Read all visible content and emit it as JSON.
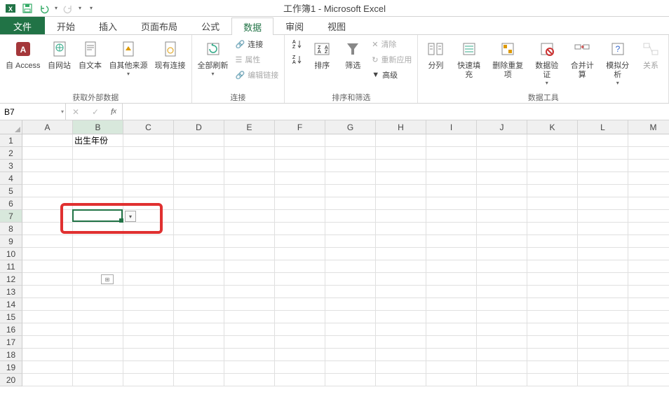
{
  "title": "工作簿1 - Microsoft Excel",
  "tabs": {
    "file": "文件",
    "home": "开始",
    "insert": "插入",
    "layout": "页面布局",
    "formulas": "公式",
    "data": "数据",
    "review": "审阅",
    "view": "视图"
  },
  "ribbon": {
    "group_external": "获取外部数据",
    "from_access": "自 Access",
    "from_web": "自网站",
    "from_text": "自文本",
    "from_other": "自其他来源",
    "existing_conn": "现有连接",
    "group_conn": "连接",
    "refresh_all": "全部刷新",
    "connections": "连接",
    "properties": "属性",
    "edit_links": "编辑链接",
    "group_sort": "排序和筛选",
    "sort": "排序",
    "filter": "筛选",
    "clear": "清除",
    "reapply": "重新应用",
    "advanced": "高级",
    "group_tools": "数据工具",
    "text_to_cols": "分列",
    "flash_fill": "快速填充",
    "remove_dup": "删除重复项",
    "data_valid": "数据验证",
    "consolidate": "合并计算",
    "whatif": "模拟分析",
    "relationships": "关系"
  },
  "name_box": "B7",
  "formula": "",
  "columns": [
    "A",
    "B",
    "C",
    "D",
    "E",
    "F",
    "G",
    "H",
    "I",
    "J",
    "K",
    "L",
    "M"
  ],
  "rows": [
    "1",
    "2",
    "3",
    "4",
    "5",
    "6",
    "7",
    "8",
    "9",
    "10",
    "11",
    "12",
    "13",
    "14",
    "15",
    "16",
    "17",
    "18",
    "19",
    "20"
  ],
  "cells": {
    "B1": "出生年份"
  },
  "selected": {
    "colIndex": 1,
    "rowIndex": 6
  }
}
